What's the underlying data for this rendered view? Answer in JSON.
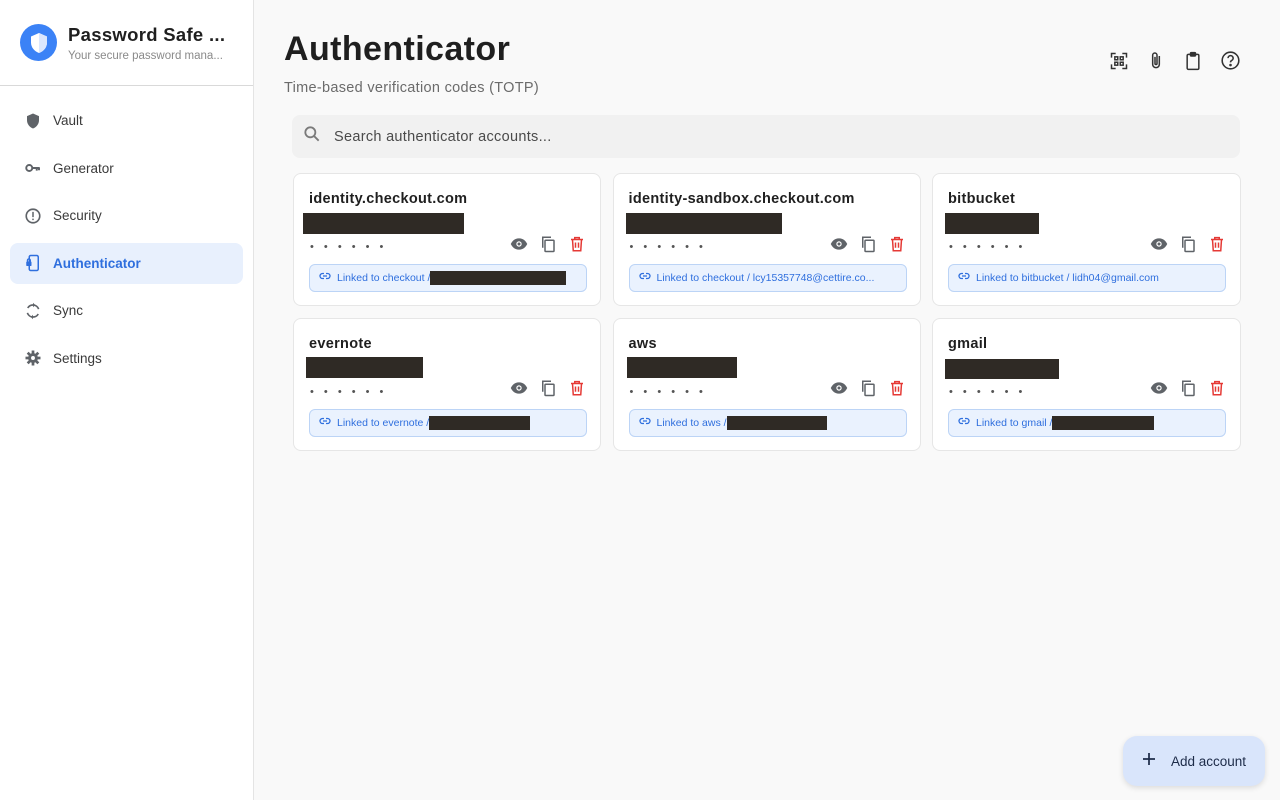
{
  "sidebar": {
    "app_title": "Password Safe ...",
    "app_subtitle": "Your secure password mana...",
    "items": [
      {
        "label": "Vault",
        "icon": "shield-icon",
        "active": false
      },
      {
        "label": "Generator",
        "icon": "key-icon",
        "active": false
      },
      {
        "label": "Security",
        "icon": "alert-circle-icon",
        "active": false
      },
      {
        "label": "Authenticator",
        "icon": "phone-lock-icon",
        "active": true
      },
      {
        "label": "Sync",
        "icon": "sync-icon",
        "active": false
      },
      {
        "label": "Settings",
        "icon": "gear-icon",
        "active": false
      }
    ]
  },
  "header": {
    "title": "Authenticator",
    "subtitle": "Time-based verification codes (TOTP)",
    "tools": [
      "qr-scan-icon",
      "attachment-icon",
      "clipboard-icon",
      "help-icon"
    ]
  },
  "search": {
    "placeholder": "Search authenticator accounts..."
  },
  "accounts": [
    {
      "name": "identity.checkout.com",
      "code": "• • • • • •",
      "link_text": "Linked to checkout / ",
      "link_redacted": true
    },
    {
      "name": "identity-sandbox.checkout.com",
      "code": "• • • • • •",
      "link_text": "Linked to checkout / lcy15357748@cettire.co...",
      "link_redacted": false
    },
    {
      "name": "bitbucket",
      "code": "• • • • • •",
      "link_text": "Linked to bitbucket / lidh04@gmail.com",
      "link_redacted": false
    },
    {
      "name": "evernote",
      "code": "• • • • • •",
      "link_text": "Linked to evernote / ",
      "link_redacted": true
    },
    {
      "name": "aws",
      "code": "• • • • • •",
      "link_text": "Linked to aws / ",
      "link_redacted": true
    },
    {
      "name": "gmail",
      "code": "• • • • • •",
      "link_text": "Linked to gmail / ",
      "link_redacted": true
    }
  ],
  "fab": {
    "label": "Add account"
  },
  "colors": {
    "accent": "#3b82f6",
    "active_bg": "#e8f0fd",
    "danger": "#e53935",
    "redaction": "#2f2a25"
  }
}
